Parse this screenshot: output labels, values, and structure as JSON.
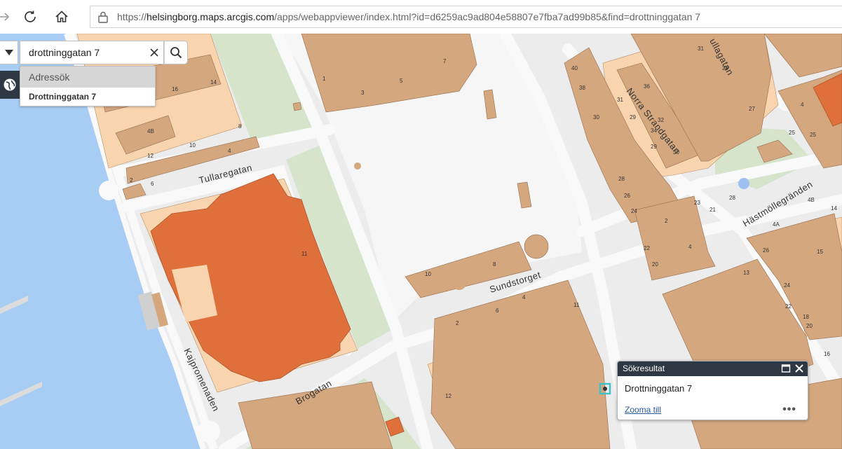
{
  "browser": {
    "url_prefix": "https://",
    "url_host": "helsingborg.maps.arcgis.com",
    "url_path": "/apps/webappviewer/index.html?id=d6259ac9ad804e58807e7fba7ad99b85&find=drottninggatan 7",
    "icons": [
      "forward-icon",
      "reload-icon",
      "home-icon",
      "lock-icon"
    ]
  },
  "search": {
    "value": "drottninggatan 7",
    "suggest_header": "Adressök",
    "suggest_item": "Drottninggatan 7"
  },
  "popup": {
    "title": "Sökresultat",
    "content": "Drottninggatan 7",
    "zoom_link": "Zooma till",
    "more": "•••"
  },
  "map": {
    "streets": [
      "Tullaregatan",
      "Sundstorget",
      "Brogatan",
      "Kajpromenaden",
      "Norra Strandgatan",
      "Hästmöllegränden",
      "ullagatan"
    ],
    "house_numbers": [
      "1",
      "3",
      "5",
      "7",
      "14",
      "16",
      "14",
      "8",
      "4B",
      "12",
      "10",
      "6",
      "4",
      "2",
      "6",
      "2",
      "11",
      "10",
      "8",
      "2",
      "6",
      "11",
      "12",
      "40",
      "38",
      "36",
      "34",
      "32",
      "31",
      "30",
      "29",
      "27",
      "26",
      "25",
      "31",
      "29",
      "28",
      "26",
      "24",
      "23",
      "2",
      "4",
      "22",
      "20",
      "21",
      "28",
      "4B",
      "4A",
      "26",
      "24",
      "22",
      "20",
      "18",
      "16",
      "13",
      "16",
      "15",
      "14",
      "4",
      "25"
    ],
    "colors": {
      "water": "#a8cdf5",
      "park": "#d6e4cc",
      "road": "#f9f9f9",
      "block": "#ececec",
      "building": "#d4a77f",
      "residential": "#f9d5af",
      "highlight": "#e0703b",
      "marker": "#41c2c7"
    }
  }
}
